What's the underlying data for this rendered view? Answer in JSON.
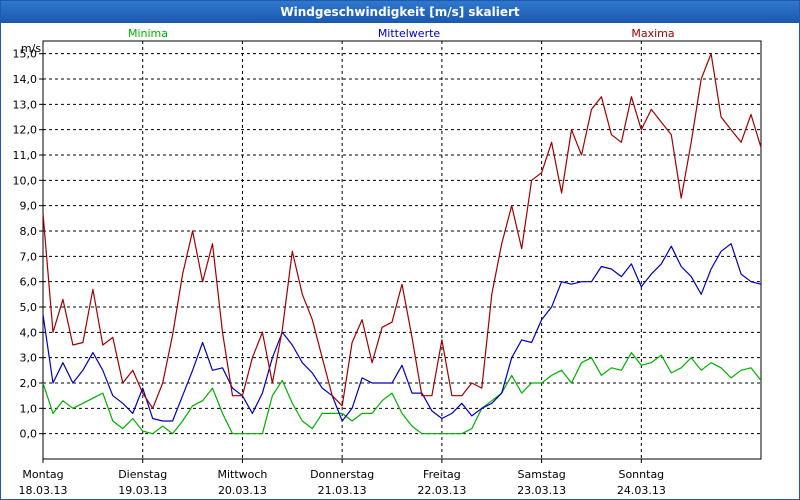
{
  "window": {
    "title": "Windgeschwindigkeit [m/s] skaliert"
  },
  "chart_data": {
    "type": "line",
    "ylabel": "m/s",
    "ylim": [
      -1.0,
      15.5
    ],
    "yticks": [
      0,
      1,
      2,
      3,
      4,
      5,
      6,
      7,
      8,
      9,
      10,
      11,
      12,
      13,
      14,
      15
    ],
    "ytick_labels": [
      "0,0",
      "1,0",
      "2,0",
      "3,0",
      "4,0",
      "5,0",
      "6,0",
      "7,0",
      "8,0",
      "9,0",
      "10,0",
      "11,0",
      "12,0",
      "13,0",
      "14,0",
      "15,0"
    ],
    "xlim": [
      0,
      7.2
    ],
    "xticks": [
      {
        "pos": 0,
        "day": "Montag",
        "date": "18.03.13"
      },
      {
        "pos": 1,
        "day": "Dienstag",
        "date": "19.03.13"
      },
      {
        "pos": 2,
        "day": "Mittwoch",
        "date": "20.03.13"
      },
      {
        "pos": 3,
        "day": "Donnerstag",
        "date": "21.03.13"
      },
      {
        "pos": 4,
        "day": "Freitag",
        "date": "22.03.13"
      },
      {
        "pos": 5,
        "day": "Samstag",
        "date": "23.03.13"
      },
      {
        "pos": 6,
        "day": "Sonntag",
        "date": "24.03.13"
      }
    ],
    "grid": true,
    "legend_position": "top",
    "series": [
      {
        "name": "Minima",
        "color": "#00b000",
        "x": [
          0.0,
          0.1,
          0.2,
          0.3,
          0.4,
          0.5,
          0.6,
          0.7,
          0.8,
          0.9,
          1.0,
          1.1,
          1.2,
          1.3,
          1.4,
          1.5,
          1.6,
          1.7,
          1.8,
          1.9,
          2.0,
          2.1,
          2.2,
          2.3,
          2.4,
          2.5,
          2.6,
          2.7,
          2.8,
          2.9,
          3.0,
          3.1,
          3.2,
          3.3,
          3.4,
          3.5,
          3.6,
          3.7,
          3.8,
          3.9,
          4.0,
          4.1,
          4.2,
          4.3,
          4.4,
          4.5,
          4.6,
          4.7,
          4.8,
          4.9,
          5.0,
          5.1,
          5.2,
          5.3,
          5.4,
          5.5,
          5.6,
          5.7,
          5.8,
          5.9,
          6.0,
          6.1,
          6.2,
          6.3,
          6.4,
          6.5,
          6.6,
          6.7,
          6.8,
          6.9,
          7.0,
          7.1,
          7.2
        ],
        "values": [
          2.0,
          0.8,
          1.3,
          1.0,
          1.2,
          1.4,
          1.6,
          0.5,
          0.2,
          0.6,
          0.1,
          0.0,
          0.3,
          0.0,
          0.5,
          1.1,
          1.3,
          1.8,
          0.8,
          0.0,
          0.0,
          0.0,
          0.0,
          1.5,
          2.1,
          1.2,
          0.5,
          0.2,
          0.8,
          0.8,
          0.8,
          0.5,
          0.8,
          0.8,
          1.3,
          1.6,
          0.8,
          0.3,
          0.0,
          0.0,
          0.0,
          0.0,
          0.0,
          0.2,
          1.0,
          1.3,
          1.6,
          2.3,
          1.6,
          2.0,
          2.0,
          2.3,
          2.5,
          2.0,
          2.8,
          3.0,
          2.3,
          2.6,
          2.5,
          3.2,
          2.7,
          2.8,
          3.1,
          2.4,
          2.6,
          3.0,
          2.5,
          2.8,
          2.6,
          2.2,
          2.5,
          2.6,
          2.1
        ]
      },
      {
        "name": "Mittelwerte",
        "color": "#0000c0",
        "x": [
          0.0,
          0.1,
          0.2,
          0.3,
          0.4,
          0.5,
          0.6,
          0.7,
          0.8,
          0.9,
          1.0,
          1.1,
          1.2,
          1.3,
          1.4,
          1.5,
          1.6,
          1.7,
          1.8,
          1.9,
          2.0,
          2.1,
          2.2,
          2.3,
          2.4,
          2.5,
          2.6,
          2.7,
          2.8,
          2.9,
          3.0,
          3.1,
          3.2,
          3.3,
          3.4,
          3.5,
          3.6,
          3.7,
          3.8,
          3.9,
          4.0,
          4.1,
          4.2,
          4.3,
          4.4,
          4.5,
          4.6,
          4.7,
          4.8,
          4.9,
          5.0,
          5.1,
          5.2,
          5.3,
          5.4,
          5.5,
          5.6,
          5.7,
          5.8,
          5.9,
          6.0,
          6.1,
          6.2,
          6.3,
          6.4,
          6.5,
          6.6,
          6.7,
          6.8,
          6.9,
          7.0,
          7.1,
          7.2
        ],
        "values": [
          4.7,
          2.0,
          2.8,
          2.0,
          2.5,
          3.2,
          2.5,
          1.5,
          1.2,
          0.8,
          1.8,
          0.6,
          0.5,
          0.5,
          1.5,
          2.5,
          3.6,
          2.5,
          2.6,
          1.8,
          1.5,
          0.8,
          1.6,
          3.0,
          4.0,
          3.5,
          2.8,
          2.4,
          1.8,
          1.5,
          0.5,
          1.0,
          2.2,
          2.0,
          2.0,
          2.0,
          2.7,
          1.6,
          1.6,
          0.9,
          0.6,
          0.8,
          1.2,
          0.7,
          1.0,
          1.2,
          1.6,
          3.0,
          3.7,
          3.6,
          4.5,
          5.0,
          6.0,
          5.9,
          6.0,
          6.0,
          6.6,
          6.5,
          6.2,
          6.7,
          5.8,
          6.3,
          6.7,
          7.4,
          6.6,
          6.2,
          5.5,
          6.5,
          7.2,
          7.5,
          6.3,
          6.0,
          5.9
        ]
      },
      {
        "name": "Maxima",
        "color": "#a00000",
        "x": [
          0.0,
          0.1,
          0.2,
          0.3,
          0.4,
          0.5,
          0.6,
          0.7,
          0.8,
          0.9,
          1.0,
          1.1,
          1.2,
          1.3,
          1.4,
          1.5,
          1.6,
          1.7,
          1.8,
          1.9,
          2.0,
          2.1,
          2.2,
          2.3,
          2.4,
          2.5,
          2.6,
          2.7,
          2.8,
          2.9,
          3.0,
          3.1,
          3.2,
          3.3,
          3.4,
          3.5,
          3.6,
          3.7,
          3.8,
          3.9,
          4.0,
          4.1,
          4.2,
          4.3,
          4.4,
          4.5,
          4.6,
          4.7,
          4.8,
          4.9,
          5.0,
          5.1,
          5.2,
          5.3,
          5.4,
          5.5,
          5.6,
          5.7,
          5.8,
          5.9,
          6.0,
          6.1,
          6.2,
          6.3,
          6.4,
          6.5,
          6.6,
          6.7,
          6.8,
          6.9,
          7.0,
          7.1,
          7.2
        ],
        "values": [
          8.7,
          4.0,
          5.3,
          3.5,
          3.6,
          5.7,
          3.5,
          3.8,
          2.0,
          2.5,
          1.6,
          1.0,
          2.0,
          3.9,
          6.3,
          8.0,
          6.0,
          7.5,
          4.0,
          1.5,
          1.5,
          3.0,
          4.0,
          2.0,
          4.1,
          7.2,
          5.5,
          4.5,
          3.0,
          1.5,
          1.1,
          3.6,
          4.5,
          2.8,
          4.2,
          4.4,
          5.9,
          3.8,
          1.5,
          1.5,
          3.7,
          1.5,
          1.5,
          2.0,
          1.8,
          5.5,
          7.5,
          9.0,
          7.3,
          10.0,
          10.3,
          11.5,
          9.5,
          12.0,
          11.0,
          12.8,
          13.3,
          11.8,
          11.5,
          13.3,
          12.0,
          12.8,
          12.3,
          11.8,
          9.3,
          11.5,
          14.0,
          15.0,
          12.5,
          12.0,
          11.5,
          12.6,
          11.3
        ]
      }
    ]
  }
}
